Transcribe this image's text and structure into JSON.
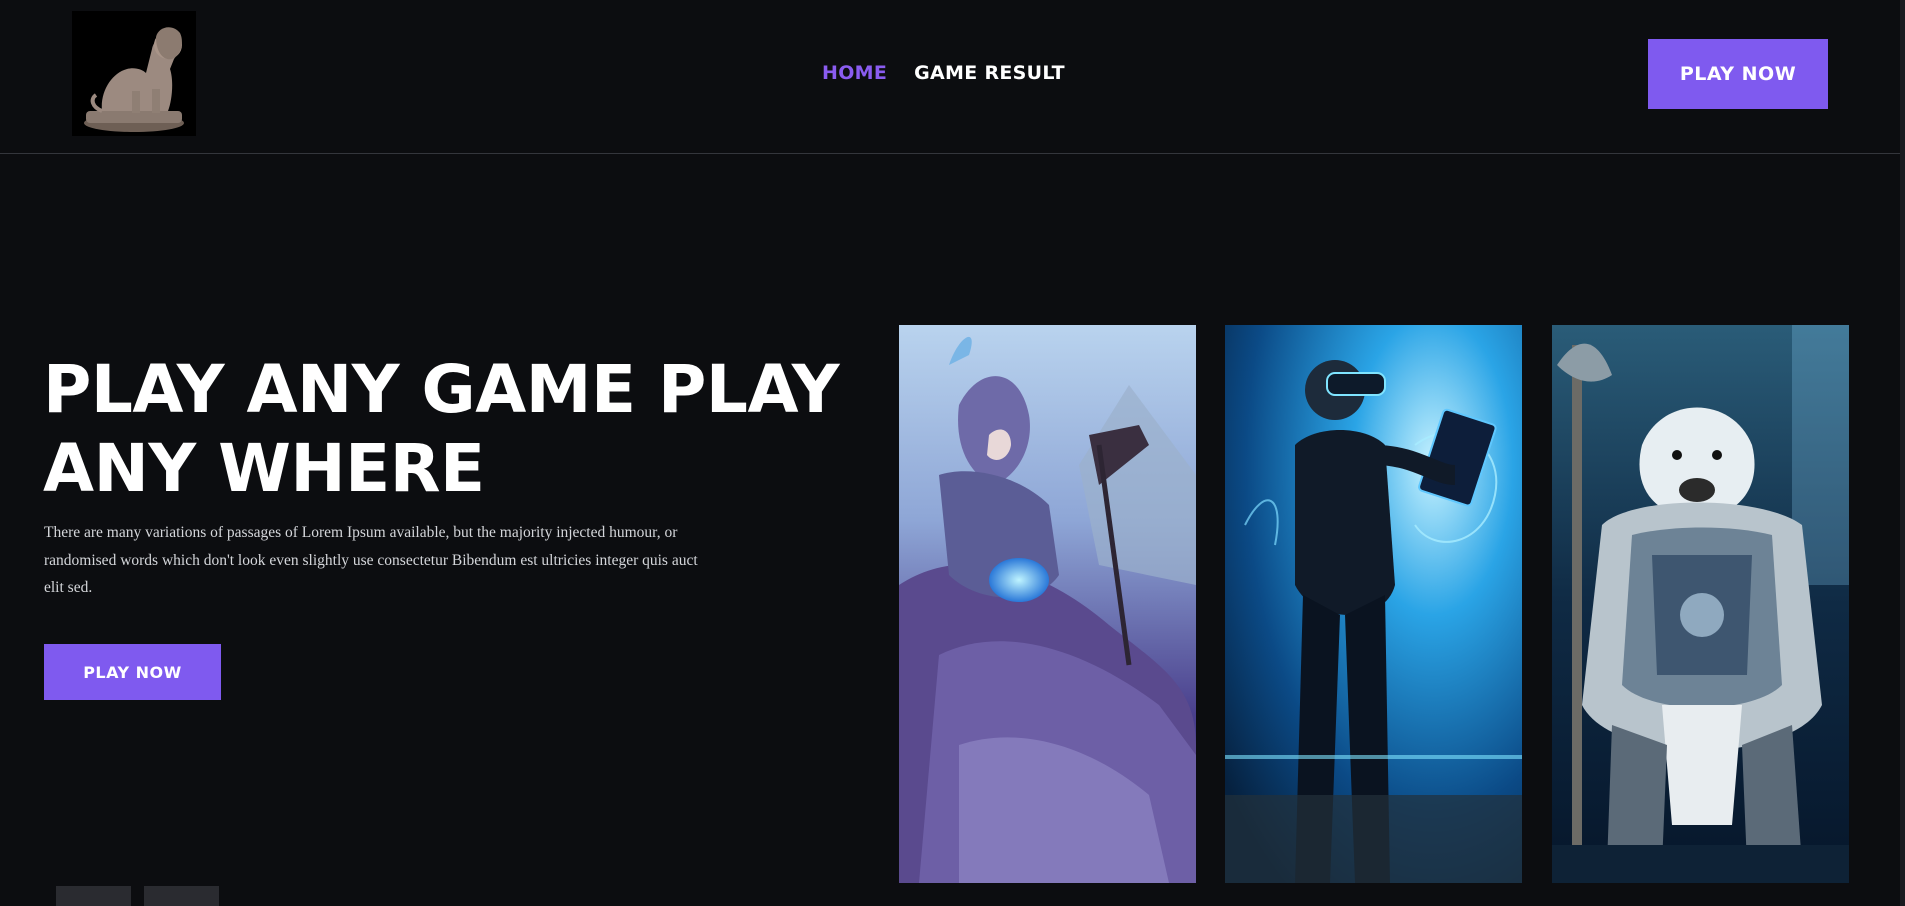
{
  "header": {
    "nav": [
      {
        "label": "HOME",
        "active": true
      },
      {
        "label": "GAME RESULT",
        "active": false
      }
    ],
    "cta_label": "PLAY NOW"
  },
  "hero": {
    "title": "PLAY ANY GAME PLAY ANY WHERE",
    "description": "There are many variations of passages of Lorem Ipsum available, but the majority injected humour, or randomised words which don't look even slightly use consectetur Bibendum est ultricies integer quis auct elit sed.",
    "cta_label": "PLAY NOW"
  },
  "cards": [
    {
      "icon": "warrior-rider-image"
    },
    {
      "icon": "vr-player-image"
    },
    {
      "icon": "polar-bear-warrior-image"
    }
  ],
  "colors": {
    "background": "#0c0d10",
    "accent": "#7f5aef",
    "nav_active": "#8a5cf0"
  }
}
